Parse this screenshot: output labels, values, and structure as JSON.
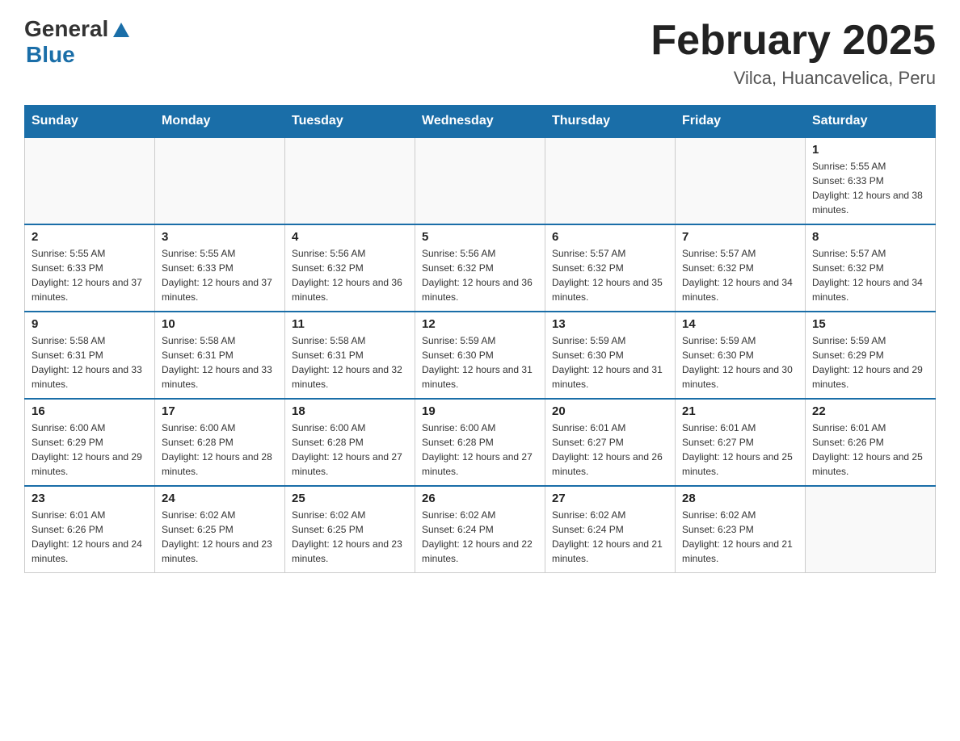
{
  "header": {
    "logo_general": "General",
    "logo_blue": "Blue",
    "month_title": "February 2025",
    "location": "Vilca, Huancavelica, Peru"
  },
  "days_of_week": [
    "Sunday",
    "Monday",
    "Tuesday",
    "Wednesday",
    "Thursday",
    "Friday",
    "Saturday"
  ],
  "weeks": [
    [
      {
        "day": "",
        "sunrise": "",
        "sunset": "",
        "daylight": "",
        "empty": true
      },
      {
        "day": "",
        "sunrise": "",
        "sunset": "",
        "daylight": "",
        "empty": true
      },
      {
        "day": "",
        "sunrise": "",
        "sunset": "",
        "daylight": "",
        "empty": true
      },
      {
        "day": "",
        "sunrise": "",
        "sunset": "",
        "daylight": "",
        "empty": true
      },
      {
        "day": "",
        "sunrise": "",
        "sunset": "",
        "daylight": "",
        "empty": true
      },
      {
        "day": "",
        "sunrise": "",
        "sunset": "",
        "daylight": "",
        "empty": true
      },
      {
        "day": "1",
        "sunrise": "Sunrise: 5:55 AM",
        "sunset": "Sunset: 6:33 PM",
        "daylight": "Daylight: 12 hours and 38 minutes.",
        "empty": false
      }
    ],
    [
      {
        "day": "2",
        "sunrise": "Sunrise: 5:55 AM",
        "sunset": "Sunset: 6:33 PM",
        "daylight": "Daylight: 12 hours and 37 minutes.",
        "empty": false
      },
      {
        "day": "3",
        "sunrise": "Sunrise: 5:55 AM",
        "sunset": "Sunset: 6:33 PM",
        "daylight": "Daylight: 12 hours and 37 minutes.",
        "empty": false
      },
      {
        "day": "4",
        "sunrise": "Sunrise: 5:56 AM",
        "sunset": "Sunset: 6:32 PM",
        "daylight": "Daylight: 12 hours and 36 minutes.",
        "empty": false
      },
      {
        "day": "5",
        "sunrise": "Sunrise: 5:56 AM",
        "sunset": "Sunset: 6:32 PM",
        "daylight": "Daylight: 12 hours and 36 minutes.",
        "empty": false
      },
      {
        "day": "6",
        "sunrise": "Sunrise: 5:57 AM",
        "sunset": "Sunset: 6:32 PM",
        "daylight": "Daylight: 12 hours and 35 minutes.",
        "empty": false
      },
      {
        "day": "7",
        "sunrise": "Sunrise: 5:57 AM",
        "sunset": "Sunset: 6:32 PM",
        "daylight": "Daylight: 12 hours and 34 minutes.",
        "empty": false
      },
      {
        "day": "8",
        "sunrise": "Sunrise: 5:57 AM",
        "sunset": "Sunset: 6:32 PM",
        "daylight": "Daylight: 12 hours and 34 minutes.",
        "empty": false
      }
    ],
    [
      {
        "day": "9",
        "sunrise": "Sunrise: 5:58 AM",
        "sunset": "Sunset: 6:31 PM",
        "daylight": "Daylight: 12 hours and 33 minutes.",
        "empty": false
      },
      {
        "day": "10",
        "sunrise": "Sunrise: 5:58 AM",
        "sunset": "Sunset: 6:31 PM",
        "daylight": "Daylight: 12 hours and 33 minutes.",
        "empty": false
      },
      {
        "day": "11",
        "sunrise": "Sunrise: 5:58 AM",
        "sunset": "Sunset: 6:31 PM",
        "daylight": "Daylight: 12 hours and 32 minutes.",
        "empty": false
      },
      {
        "day": "12",
        "sunrise": "Sunrise: 5:59 AM",
        "sunset": "Sunset: 6:30 PM",
        "daylight": "Daylight: 12 hours and 31 minutes.",
        "empty": false
      },
      {
        "day": "13",
        "sunrise": "Sunrise: 5:59 AM",
        "sunset": "Sunset: 6:30 PM",
        "daylight": "Daylight: 12 hours and 31 minutes.",
        "empty": false
      },
      {
        "day": "14",
        "sunrise": "Sunrise: 5:59 AM",
        "sunset": "Sunset: 6:30 PM",
        "daylight": "Daylight: 12 hours and 30 minutes.",
        "empty": false
      },
      {
        "day": "15",
        "sunrise": "Sunrise: 5:59 AM",
        "sunset": "Sunset: 6:29 PM",
        "daylight": "Daylight: 12 hours and 29 minutes.",
        "empty": false
      }
    ],
    [
      {
        "day": "16",
        "sunrise": "Sunrise: 6:00 AM",
        "sunset": "Sunset: 6:29 PM",
        "daylight": "Daylight: 12 hours and 29 minutes.",
        "empty": false
      },
      {
        "day": "17",
        "sunrise": "Sunrise: 6:00 AM",
        "sunset": "Sunset: 6:28 PM",
        "daylight": "Daylight: 12 hours and 28 minutes.",
        "empty": false
      },
      {
        "day": "18",
        "sunrise": "Sunrise: 6:00 AM",
        "sunset": "Sunset: 6:28 PM",
        "daylight": "Daylight: 12 hours and 27 minutes.",
        "empty": false
      },
      {
        "day": "19",
        "sunrise": "Sunrise: 6:00 AM",
        "sunset": "Sunset: 6:28 PM",
        "daylight": "Daylight: 12 hours and 27 minutes.",
        "empty": false
      },
      {
        "day": "20",
        "sunrise": "Sunrise: 6:01 AM",
        "sunset": "Sunset: 6:27 PM",
        "daylight": "Daylight: 12 hours and 26 minutes.",
        "empty": false
      },
      {
        "day": "21",
        "sunrise": "Sunrise: 6:01 AM",
        "sunset": "Sunset: 6:27 PM",
        "daylight": "Daylight: 12 hours and 25 minutes.",
        "empty": false
      },
      {
        "day": "22",
        "sunrise": "Sunrise: 6:01 AM",
        "sunset": "Sunset: 6:26 PM",
        "daylight": "Daylight: 12 hours and 25 minutes.",
        "empty": false
      }
    ],
    [
      {
        "day": "23",
        "sunrise": "Sunrise: 6:01 AM",
        "sunset": "Sunset: 6:26 PM",
        "daylight": "Daylight: 12 hours and 24 minutes.",
        "empty": false
      },
      {
        "day": "24",
        "sunrise": "Sunrise: 6:02 AM",
        "sunset": "Sunset: 6:25 PM",
        "daylight": "Daylight: 12 hours and 23 minutes.",
        "empty": false
      },
      {
        "day": "25",
        "sunrise": "Sunrise: 6:02 AM",
        "sunset": "Sunset: 6:25 PM",
        "daylight": "Daylight: 12 hours and 23 minutes.",
        "empty": false
      },
      {
        "day": "26",
        "sunrise": "Sunrise: 6:02 AM",
        "sunset": "Sunset: 6:24 PM",
        "daylight": "Daylight: 12 hours and 22 minutes.",
        "empty": false
      },
      {
        "day": "27",
        "sunrise": "Sunrise: 6:02 AM",
        "sunset": "Sunset: 6:24 PM",
        "daylight": "Daylight: 12 hours and 21 minutes.",
        "empty": false
      },
      {
        "day": "28",
        "sunrise": "Sunrise: 6:02 AM",
        "sunset": "Sunset: 6:23 PM",
        "daylight": "Daylight: 12 hours and 21 minutes.",
        "empty": false
      },
      {
        "day": "",
        "sunrise": "",
        "sunset": "",
        "daylight": "",
        "empty": true
      }
    ]
  ]
}
